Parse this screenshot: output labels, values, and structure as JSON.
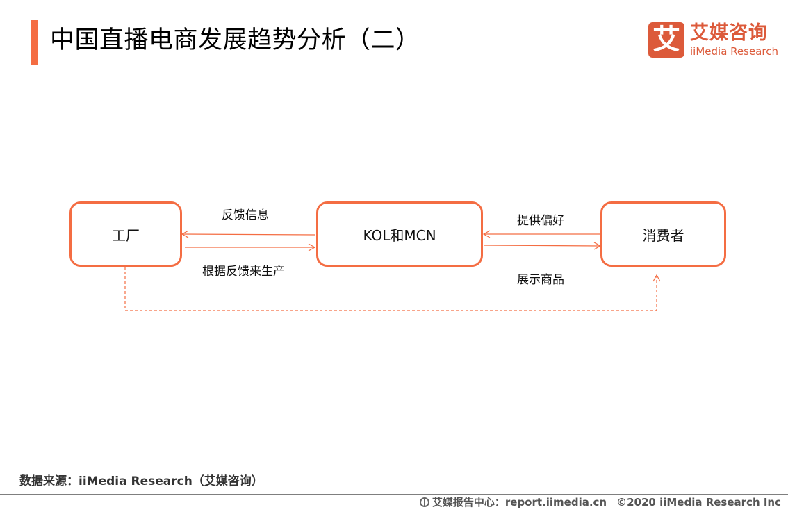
{
  "header": {
    "title": "中国直播电商发展趋势分析（二）",
    "accent_color": "#f46d43"
  },
  "logo": {
    "icon_char": "艾",
    "name_cn": "艾媒咨询",
    "name_en": "iiMedia Research",
    "color": "#dc5a3a"
  },
  "diagram": {
    "nodes": [
      {
        "id": "factory",
        "label": "工厂"
      },
      {
        "id": "kol_mcn",
        "label": "KOL和MCN"
      },
      {
        "id": "consumer",
        "label": "消费者"
      }
    ],
    "edges": [
      {
        "from": "kol_mcn",
        "to": "factory",
        "label": "反馈信息",
        "style": "solid"
      },
      {
        "from": "factory",
        "to": "kol_mcn",
        "label": "根据反馈来生产",
        "style": "solid"
      },
      {
        "from": "consumer",
        "to": "kol_mcn",
        "label": "提供偏好",
        "style": "solid"
      },
      {
        "from": "kol_mcn",
        "to": "consumer",
        "label": "展示商品",
        "style": "solid"
      },
      {
        "from": "factory",
        "to": "consumer",
        "label": "",
        "style": "dashed"
      }
    ],
    "stroke_color": "#f46d43"
  },
  "footer": {
    "source": "数据来源：iiMedia Research（艾媒咨询）",
    "report_center": "艾媒报告中心：report.iimedia.cn",
    "copyright": "©2020  iiMedia Research  Inc",
    "globe_icon": "globe-icon"
  }
}
